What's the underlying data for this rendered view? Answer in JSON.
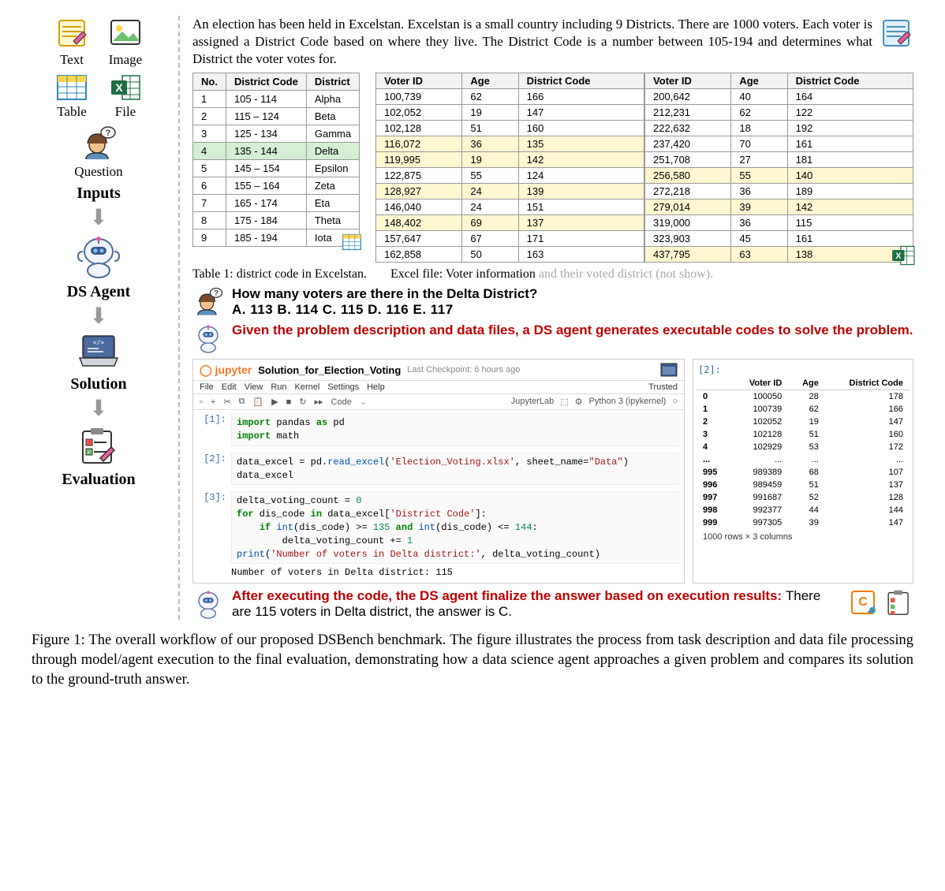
{
  "left_rail": {
    "icons": {
      "text": "Text",
      "image": "Image",
      "table": "Table",
      "file": "File",
      "question": "Question"
    },
    "headings": {
      "inputs": "Inputs",
      "ds_agent": "DS Agent",
      "solution": "Solution",
      "evaluation": "Evaluation"
    }
  },
  "intro": "An election has been held in Excelstan. Excelstan is a small country including 9 Districts. There are 1000 voters. Each voter is assigned a District Code based on where they live. The District Code is a number between 105-194 and determines what District the voter votes for.",
  "district_table": {
    "headers": [
      "No.",
      "District Code",
      "District"
    ],
    "rows": [
      {
        "no": "1",
        "code": "105 - 114",
        "name": "Alpha"
      },
      {
        "no": "2",
        "code": "115 – 124",
        "name": "Beta"
      },
      {
        "no": "3",
        "code": "125 - 134",
        "name": "Gamma"
      },
      {
        "no": "4",
        "code": "135 - 144",
        "name": "Delta",
        "highlight": true
      },
      {
        "no": "5",
        "code": "145 – 154",
        "name": "Epsilon"
      },
      {
        "no": "6",
        "code": "155 – 164",
        "name": "Zeta"
      },
      {
        "no": "7",
        "code": "165 - 174",
        "name": "Eta"
      },
      {
        "no": "8",
        "code": "175 - 184",
        "name": "Theta"
      },
      {
        "no": "9",
        "code": "185 - 194",
        "name": "Iota"
      }
    ]
  },
  "voter_table": {
    "headers": [
      "Voter ID",
      "Age",
      "District Code"
    ],
    "left": [
      {
        "id": "100,739",
        "age": "62",
        "code": "166"
      },
      {
        "id": "102,052",
        "age": "19",
        "code": "147"
      },
      {
        "id": "102,128",
        "age": "51",
        "code": "160"
      },
      {
        "id": "116,072",
        "age": "36",
        "code": "135",
        "hl": true
      },
      {
        "id": "119,995",
        "age": "19",
        "code": "142",
        "hl": true
      },
      {
        "id": "122,875",
        "age": "55",
        "code": "124"
      },
      {
        "id": "128,927",
        "age": "24",
        "code": "139",
        "hl": true
      },
      {
        "id": "146,040",
        "age": "24",
        "code": "151"
      },
      {
        "id": "148,402",
        "age": "69",
        "code": "137",
        "hl": true
      },
      {
        "id": "157,647",
        "age": "67",
        "code": "171"
      },
      {
        "id": "162,858",
        "age": "50",
        "code": "163"
      }
    ],
    "right": [
      {
        "id": "200,642",
        "age": "40",
        "code": "164"
      },
      {
        "id": "212,231",
        "age": "62",
        "code": "122"
      },
      {
        "id": "222,632",
        "age": "18",
        "code": "192"
      },
      {
        "id": "237,420",
        "age": "70",
        "code": "161"
      },
      {
        "id": "251,708",
        "age": "27",
        "code": "181"
      },
      {
        "id": "256,580",
        "age": "55",
        "code": "140",
        "hl": true
      },
      {
        "id": "272,218",
        "age": "36",
        "code": "189"
      },
      {
        "id": "279,014",
        "age": "39",
        "code": "142",
        "hl": true
      },
      {
        "id": "319,000",
        "age": "36",
        "code": "115"
      },
      {
        "id": "323,903",
        "age": "45",
        "code": "161"
      },
      {
        "id": "437,795",
        "age": "63",
        "code": "138",
        "hl": true
      }
    ]
  },
  "captions": {
    "table1": "Table 1: district code in Excelstan.",
    "excel": "Excel file: Voter information",
    "excel_grey": " and their voted district (not show)."
  },
  "question": {
    "text": "How many voters are there in the Delta District?",
    "options": "A. 113    B. 114    C. 115    D. 116    E. 117"
  },
  "agent_message": "Given the problem description and data files, a DS agent generates executable codes to solve the problem.",
  "notebook": {
    "title": "Solution_for_Election_Voting",
    "checkpoint": "Last Checkpoint: 6 hours ago",
    "trusted": "Trusted",
    "menu": [
      "File",
      "Edit",
      "View",
      "Run",
      "Kernel",
      "Settings",
      "Help"
    ],
    "toolbar_dropdown": "Code",
    "kernel_label": "JupyterLab",
    "kernel_name": "Python 3 (ipykernel)",
    "output_text": "Number of voters in Delta district: 115"
  },
  "dataframe": {
    "prompt": "[2]:",
    "headers": [
      "",
      "Voter ID",
      "Age",
      "District Code"
    ],
    "rows": [
      [
        "0",
        "100050",
        "28",
        "178"
      ],
      [
        "1",
        "100739",
        "62",
        "166"
      ],
      [
        "2",
        "102052",
        "19",
        "147"
      ],
      [
        "3",
        "102128",
        "51",
        "160"
      ],
      [
        "4",
        "102929",
        "53",
        "172"
      ],
      [
        "...",
        "...",
        "...",
        "..."
      ],
      [
        "995",
        "989389",
        "68",
        "107"
      ],
      [
        "996",
        "989459",
        "51",
        "137"
      ],
      [
        "997",
        "991687",
        "52",
        "128"
      ],
      [
        "998",
        "992377",
        "44",
        "144"
      ],
      [
        "999",
        "997305",
        "39",
        "147"
      ]
    ],
    "footer": "1000 rows × 3 columns"
  },
  "answer": {
    "red": "After executing the code, the DS agent finalize the answer based on execution results: ",
    "black": "There are 115 voters in Delta district, the answer is C."
  },
  "figure_caption": "Figure 1: The overall workflow of our proposed DSBench benchmark. The figure illustrates the process from task description and data file processing through model/agent execution to the final evaluation, demonstrating how a data science agent approaches a given problem and compares its solution to the ground-truth answer."
}
